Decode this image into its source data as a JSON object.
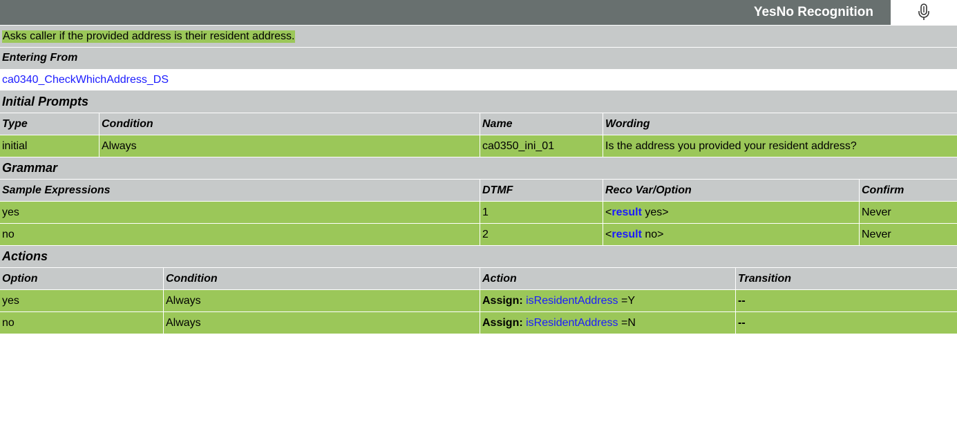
{
  "title_bar": {
    "title": "YesNo Recognition",
    "icon": "microphone-icon"
  },
  "description": "Asks caller if the provided address is their resident address.",
  "entering_from": {
    "heading": "Entering From",
    "link": "ca0340_CheckWhichAddress_DS"
  },
  "initial_prompts": {
    "heading": "Initial Prompts",
    "columns": [
      "Type",
      "Condition",
      "Name",
      "Wording"
    ],
    "rows": [
      [
        "initial",
        "Always",
        "ca0350_ini_01",
        "Is the address you provided your resident address?"
      ]
    ]
  },
  "grammar": {
    "heading": "Grammar",
    "columns": [
      "Sample Expressions",
      "DTMF",
      "Reco Var/Option",
      "Confirm"
    ],
    "rows": [
      {
        "expr": "yes",
        "dtmf": "1",
        "reco_open": "<",
        "reco_key": "result",
        "reco_val": " yes>",
        "confirm": "Never"
      },
      {
        "expr": "no",
        "dtmf": "2",
        "reco_open": "<",
        "reco_key": "result",
        "reco_val": " no>",
        "confirm": "Never"
      }
    ]
  },
  "actions": {
    "heading": "Actions",
    "columns": [
      "Option",
      "Condition",
      "Action",
      "Transition"
    ],
    "rows": [
      {
        "option": "yes",
        "condition": "Always",
        "assign_label": "Assign:",
        "var": "isResidentAddress",
        "val": " =Y",
        "transition": "--"
      },
      {
        "option": "no",
        "condition": "Always",
        "assign_label": "Assign:",
        "var": "isResidentAddress",
        "val": " =N",
        "transition": "--"
      }
    ]
  },
  "colors": {
    "title_bar": "#68706f",
    "section_grey": "#c6c9c9",
    "row_green": "#9bc759",
    "link_blue": "#1a1aff"
  }
}
